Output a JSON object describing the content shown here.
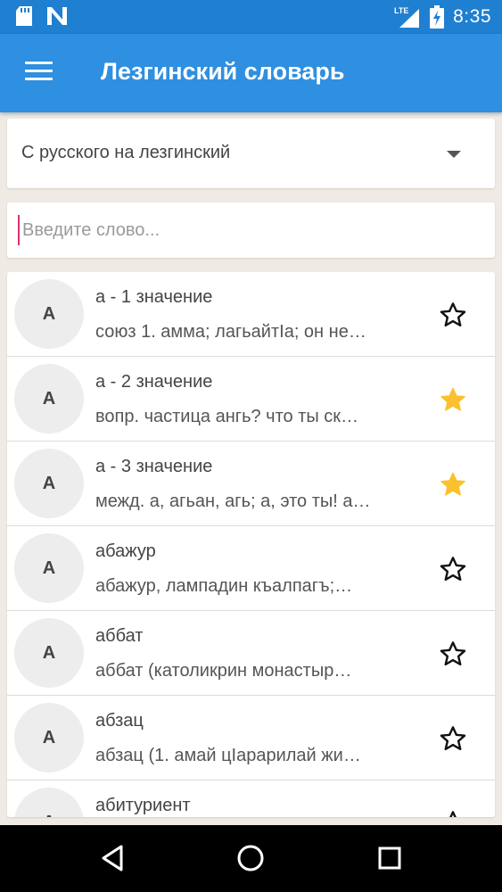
{
  "status_bar": {
    "time": "8:35",
    "network": "LTE",
    "icons": [
      "sd-card-icon",
      "n-app-icon",
      "lte-signal-icon",
      "battery-charging-icon"
    ]
  },
  "app_bar": {
    "title": "Лезгинский словарь",
    "menu_icon": "hamburger-menu-icon"
  },
  "direction_select": {
    "selected": "С русского на лезгинский"
  },
  "search": {
    "placeholder": "Введите слово...",
    "value": ""
  },
  "colors": {
    "status_bar": "#1f7fd0",
    "app_bar": "#2f8fe0",
    "background": "#efebe4",
    "star_filled": "#fbc02d",
    "cursor": "#d8336b"
  },
  "entries": [
    {
      "letter": "А",
      "word": "а - 1 значение",
      "definition": "союз 1. амма; лагьайтIа; он не…",
      "favorite": false
    },
    {
      "letter": "А",
      "word": "а - 2 значение",
      "definition": "вопр. частица ангь? что ты ск…",
      "favorite": true
    },
    {
      "letter": "А",
      "word": "а - 3 значение",
      "definition": "межд. а, агьан, агь; а, это ты! а…",
      "favorite": true
    },
    {
      "letter": "А",
      "word": "абажур",
      "definition": "абажур, лампадин къалпагъ;…",
      "favorite": false
    },
    {
      "letter": "А",
      "word": "аббат",
      "definition": "аббат (католикрин монастыр…",
      "favorite": false
    },
    {
      "letter": "А",
      "word": "абзац",
      "definition": "абзац (1. амай цIарарилай жи…",
      "favorite": false
    },
    {
      "letter": "А",
      "word": "абитуриент",
      "definition": "",
      "favorite": false
    }
  ],
  "nav_bar": {
    "back_icon": "back-triangle-icon",
    "home_icon": "home-circle-icon",
    "recents_icon": "recents-square-icon"
  }
}
